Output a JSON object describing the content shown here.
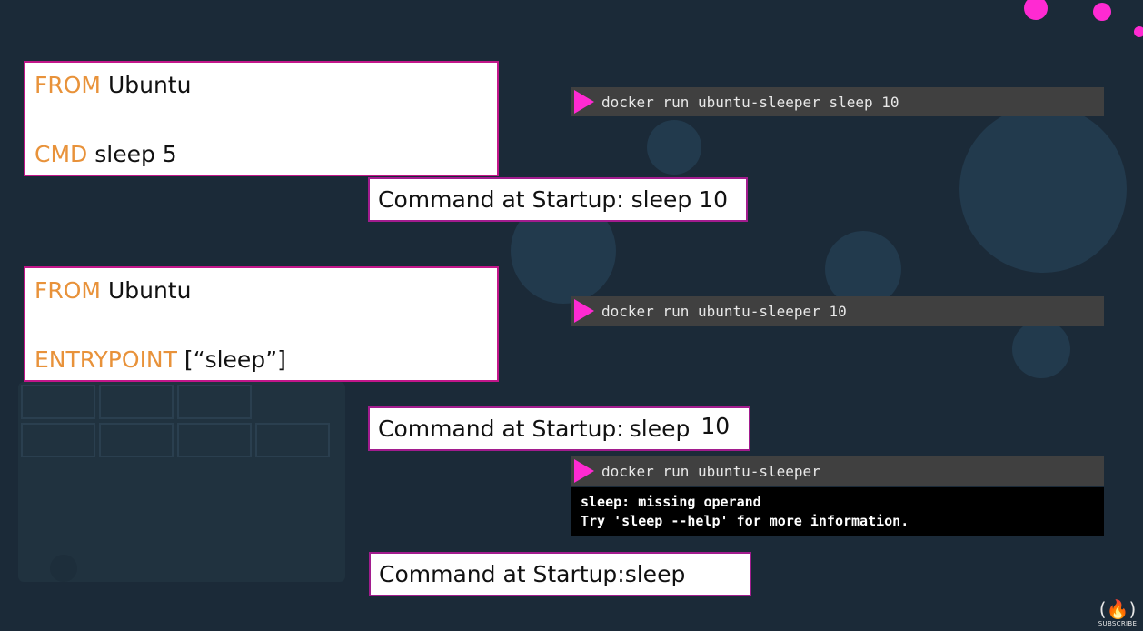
{
  "examples": [
    {
      "dockerfile": [
        {
          "keyword": "FROM",
          "arg": " Ubuntu"
        },
        {
          "keyword": "CMD",
          "arg": " sleep 5"
        }
      ],
      "command": "docker run ubuntu-sleeper sleep 10",
      "startup_label": "Command at Startup: sleep 10"
    },
    {
      "dockerfile": [
        {
          "keyword": "FROM",
          "arg": " Ubuntu"
        },
        {
          "keyword": "ENTRYPOINT",
          "arg": " [“sleep”]"
        }
      ],
      "command": "docker run ubuntu-sleeper 10",
      "startup_label": "Command at Startup:",
      "startup_parts": [
        "sleep",
        "10"
      ]
    },
    {
      "command": "docker run ubuntu-sleeper",
      "output": [
        "sleep: missing operand",
        "Try 'sleep --help' for more information."
      ],
      "startup_label": "Command at Startup:sleep"
    }
  ],
  "subscribe": {
    "icon": "freecodecamp-flame-icon",
    "label": "SUBSCRIBE"
  },
  "colors": {
    "background": "#1b2a38",
    "keyword": "#e8923a",
    "border": "#c2168a",
    "play": "#ff2ad2",
    "terminal_bar": "#404040",
    "decor_circle": "#2a4458",
    "decor_pink": "#ff2ad2"
  }
}
